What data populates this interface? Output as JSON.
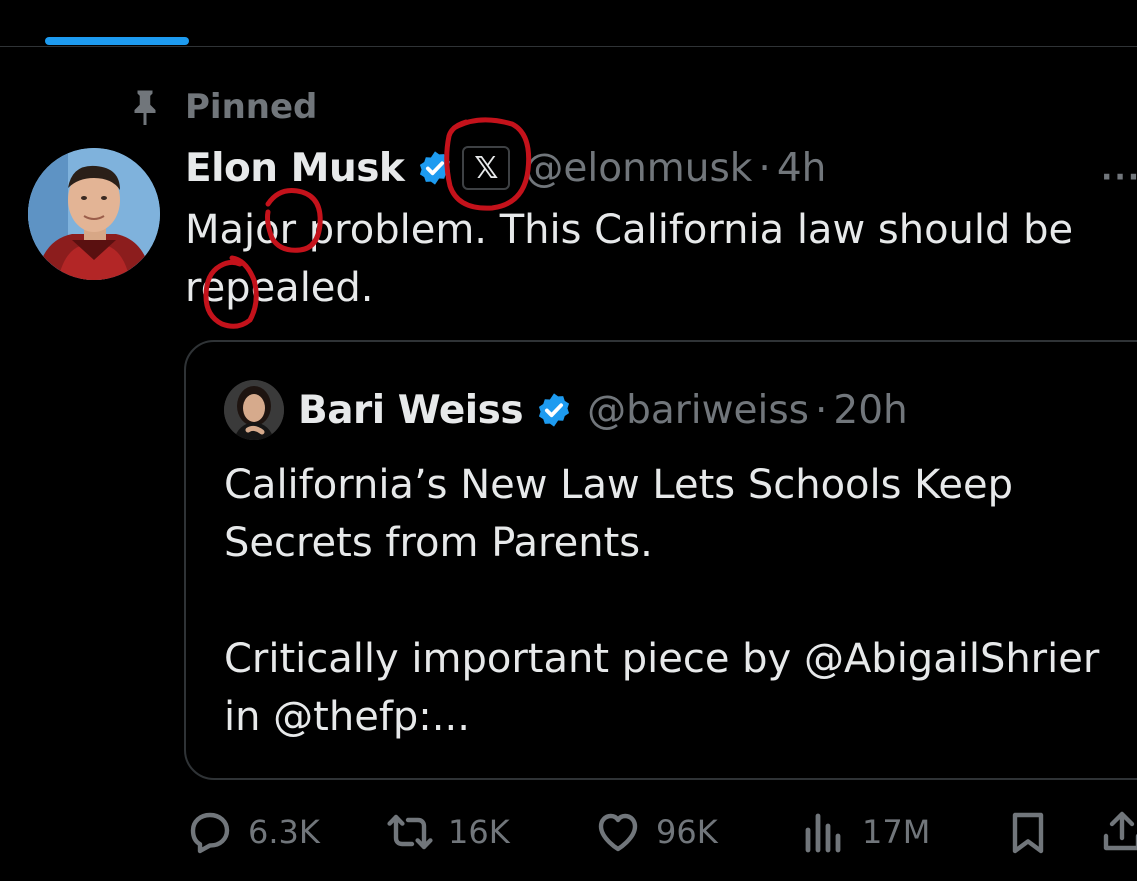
{
  "pinned": {
    "label": "Pinned"
  },
  "tweet": {
    "author_name": "Elon Musk",
    "affiliate_badge": "𝕏",
    "handle": "@elonmusk",
    "separator": "·",
    "time": "4h",
    "more": "···",
    "text": "Major problem. This California law should be repealed."
  },
  "quote": {
    "author_name": "Bari Weiss",
    "handle": "@bariweiss",
    "separator": "·",
    "time": "20h",
    "text": "California’s New Law Lets Schools Keep Secrets from Parents.\n\nCritically important piece by @AbigailShrier in @thefp:..."
  },
  "actions": {
    "replies": "6.3K",
    "reposts": "16K",
    "likes": "96K",
    "views": "17M"
  },
  "colors": {
    "accent": "#1d9bf0",
    "muted": "#71767b",
    "annotation": "#c4121b"
  }
}
